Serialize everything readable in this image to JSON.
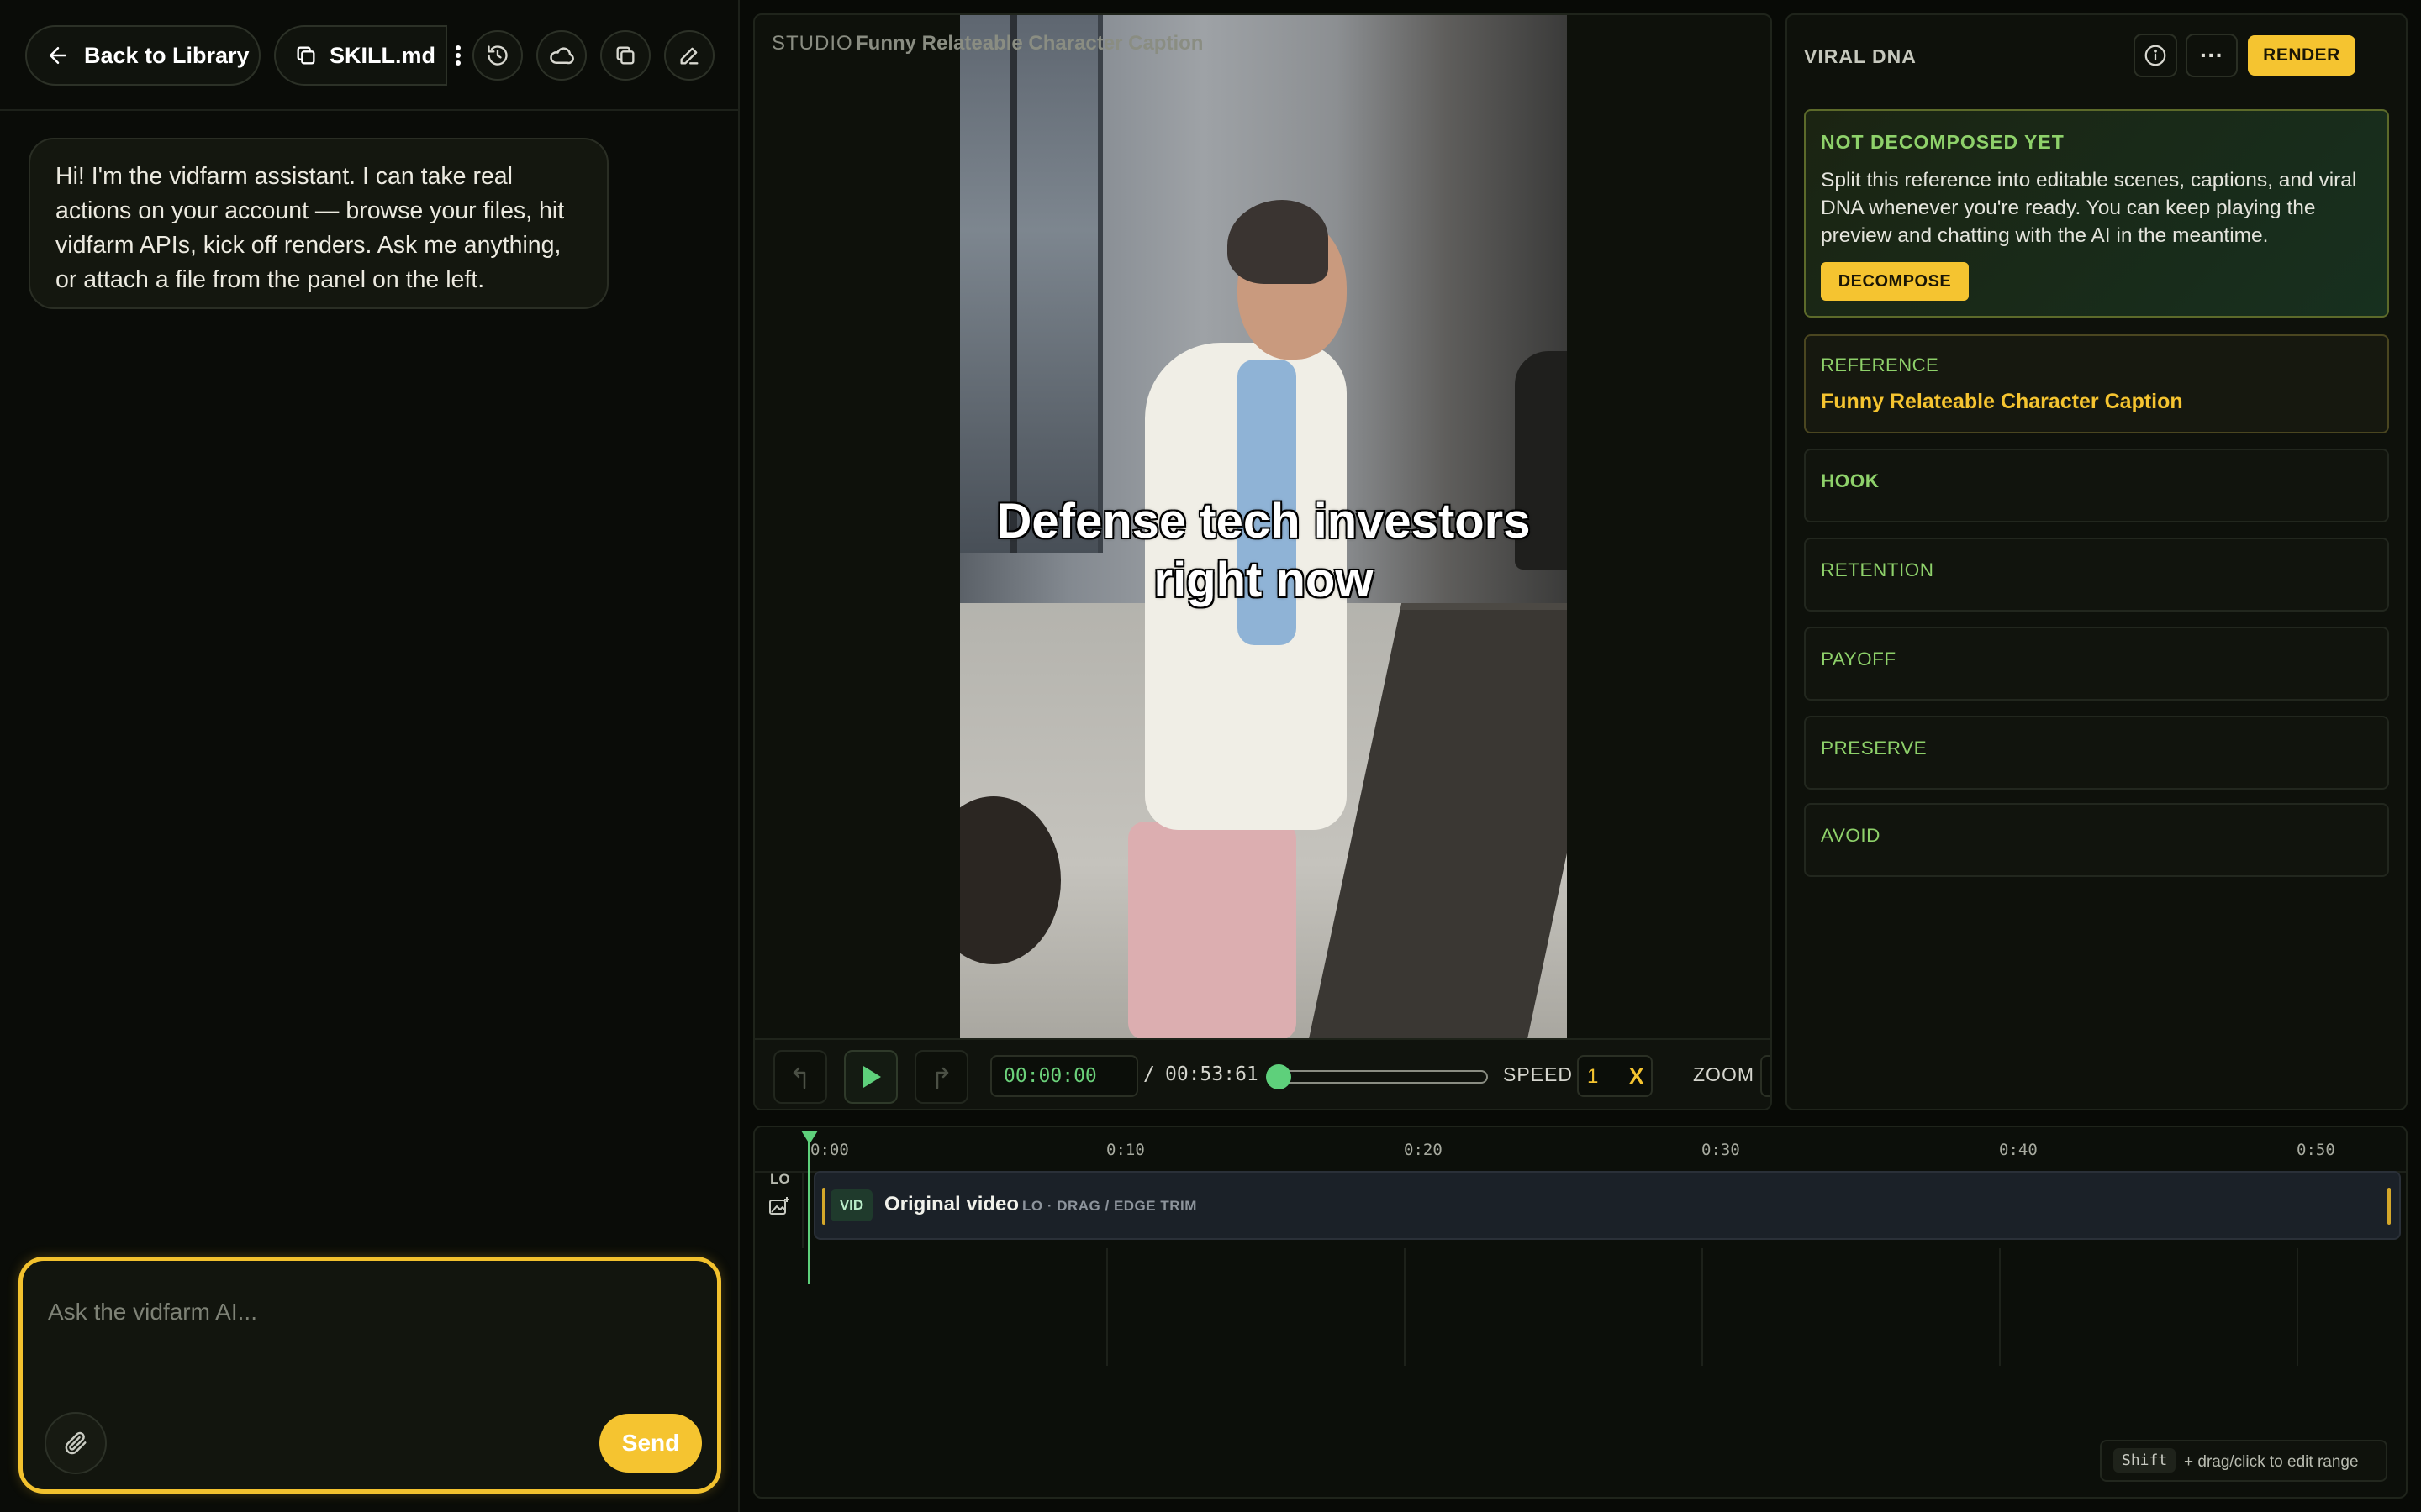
{
  "toolbar": {
    "back_label": "Back to Library",
    "file_label": "SKILL.md",
    "icons": [
      "history-icon",
      "cloud-icon",
      "copy-icon",
      "edit-icon"
    ]
  },
  "chat": {
    "assistant_message": "Hi! I'm the vidfarm assistant. I can take real actions on your account — browse your files, hit vidfarm APIs, kick off renders. Ask me anything, or attach a file from the panel on the left.",
    "input_placeholder": "Ask the vidfarm AI...",
    "input_value": "",
    "send_label": "Send"
  },
  "preview": {
    "studio_label": "STUDIO",
    "project_title": "Funny Relateable Character Caption",
    "caption_text": "Defense tech investors right now"
  },
  "player": {
    "current_time": "00:00:00",
    "separator": "/",
    "total_time": "00:53:61",
    "progress": 0,
    "speed_label": "SPEED",
    "speed_value": "1",
    "speed_suffix": "X",
    "zoom_label": "ZOOM"
  },
  "viral_dna": {
    "title": "VIRAL DNA",
    "more_label": "···",
    "render_label": "RENDER",
    "status_title": "NOT DECOMPOSED YET",
    "status_text": "Split this reference into editable scenes, captions, and viral DNA whenever you're ready. You can keep playing the preview and chatting with the AI in the meantime.",
    "decompose_label": "DECOMPOSE",
    "reference_label": "REFERENCE",
    "reference_title": "Funny Relateable Character Caption",
    "sections": [
      "HOOK",
      "RETENTION",
      "PAYOFF",
      "PRESERVE",
      "AVOID"
    ]
  },
  "timeline": {
    "ticks": [
      "0:00",
      "0:10",
      "0:20",
      "0:30",
      "0:40",
      "0:50"
    ],
    "track_label": "LO",
    "clip_badge": "VID",
    "clip_title": "Original video",
    "clip_subtitle": "LO · DRAG / EDGE TRIM",
    "hint_key": "Shift",
    "hint_text": "+ drag/click to edit range"
  },
  "colors": {
    "accent": "#f5c430",
    "success": "#5ed07b",
    "section_label": "#8ed16a",
    "background": "#080a06"
  }
}
